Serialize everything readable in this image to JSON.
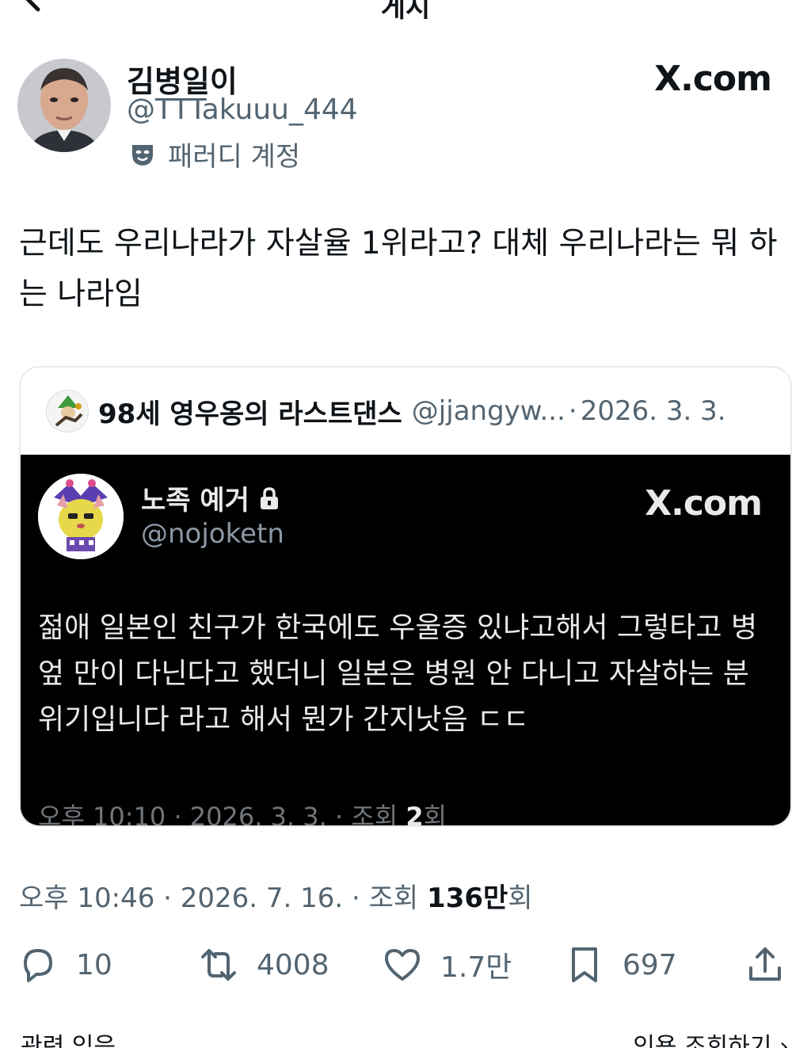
{
  "header": {
    "title": "게시"
  },
  "author": {
    "name": "김병일이",
    "handle": "@TTTakuuu_444",
    "badge": "패러디 계정",
    "watermark": "X.com"
  },
  "post": {
    "text": "근데도 우리나라가 자살율 1위라고? 대체 우리나라는 뭐 하는 나라임"
  },
  "quote": {
    "name": "98세 영우옹의 라스트댄스",
    "handle": "@jjangyw...",
    "separator": "·",
    "date": "2026. 3. 3.",
    "embed": {
      "name": "노족 예거",
      "handle": "@nojoketn",
      "watermark": "X.com",
      "text": "젊애 일본인 친구가 한국에도 우울증 있냐고해서 그렇타고 병엎 만이 다닌다고 했더니 일본은 병원 안 다니고 자살하는 분위기입니다 라고 해서 뭔가 간지낫음 ㄷㄷ",
      "meta_prefix": "오후 10:10 · 2026. 3. 3. · 조회 ",
      "meta_views": "2",
      "meta_suffix": "회"
    }
  },
  "meta": {
    "prefix": "오후 10:46 · 2026. 7. 16. · 조회 ",
    "views": "136만",
    "suffix": "회"
  },
  "actions": {
    "replies": "10",
    "reposts": "4008",
    "likes": "1.7만",
    "bookmarks": "697"
  },
  "bottom": {
    "left": "관련 있음 ⌄",
    "right": "인용 조회하기 ›"
  },
  "colors": {
    "text": "#0f1419",
    "secondary": "#536471",
    "embed_bg": "#000000"
  }
}
